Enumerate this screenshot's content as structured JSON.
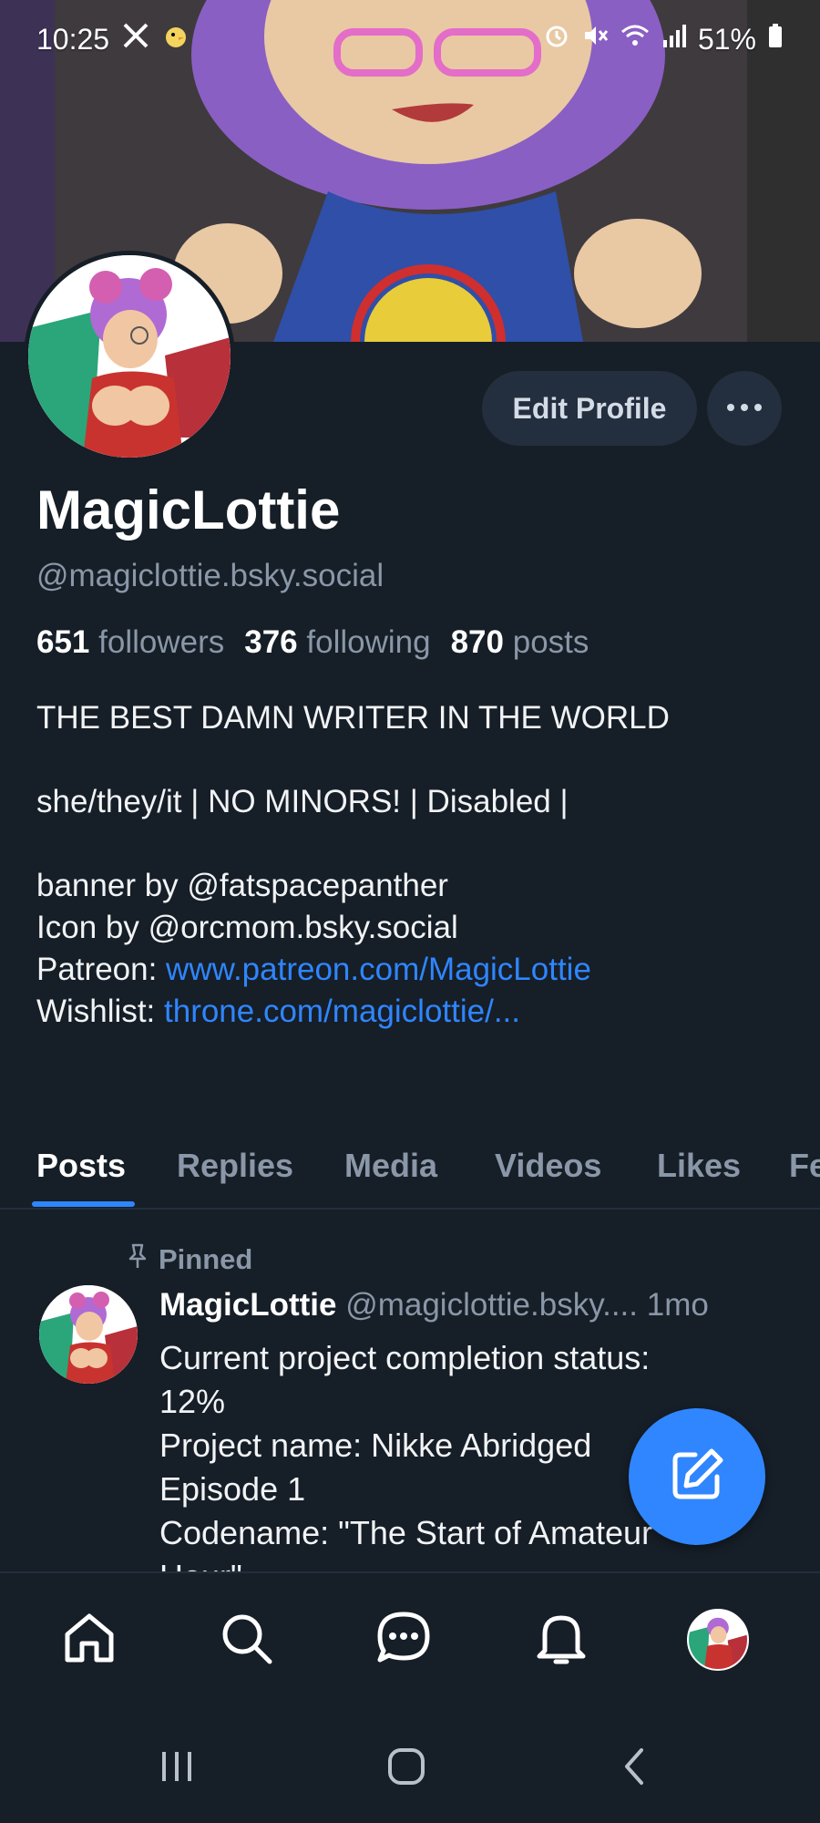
{
  "status_bar": {
    "time": "10:25",
    "battery": "51%"
  },
  "profile": {
    "display_name": "MagicLottie",
    "handle": "@magiclottie.bsky.social",
    "edit_button": "Edit Profile",
    "stats": {
      "followers_count": "651",
      "followers_label": "followers",
      "following_count": "376",
      "following_label": "following",
      "posts_count": "870",
      "posts_label": "posts"
    },
    "bio": {
      "line1": "THE BEST DAMN WRITER IN THE WORLD",
      "line2": "she/they/it | NO MINORS! | Disabled |",
      "line3": "banner by @fatspacepanther",
      "line4": "Icon by @orcmom.bsky.social",
      "patreon_label": "Patreon: ",
      "patreon_link": "www.patreon.com/MagicLottie",
      "wishlist_label": "Wishlist: ",
      "wishlist_link": "throne.com/magiclottie/..."
    }
  },
  "tabs": [
    "Posts",
    "Replies",
    "Media",
    "Videos",
    "Likes",
    "Fe"
  ],
  "pinned_post": {
    "pinned_label": "Pinned",
    "author": "MagicLottie",
    "handle": "@magiclottie.bsky....",
    "time": "1mo",
    "lines": [
      "Current project completion status:",
      "12%",
      "Project name: Nikke Abridged",
      "Episode 1",
      "Codename: \"The Start of Amateur",
      "Hour\""
    ]
  },
  "colors": {
    "background": "#161e27",
    "accent": "#2f86ff",
    "muted": "#8a97a8",
    "button_bg": "#232e3e"
  },
  "icons": {
    "nav": [
      "home-icon",
      "search-icon",
      "chat-icon",
      "bell-icon",
      "profile-avatar"
    ],
    "system": [
      "recents-icon",
      "home-circle-icon",
      "back-icon"
    ]
  }
}
